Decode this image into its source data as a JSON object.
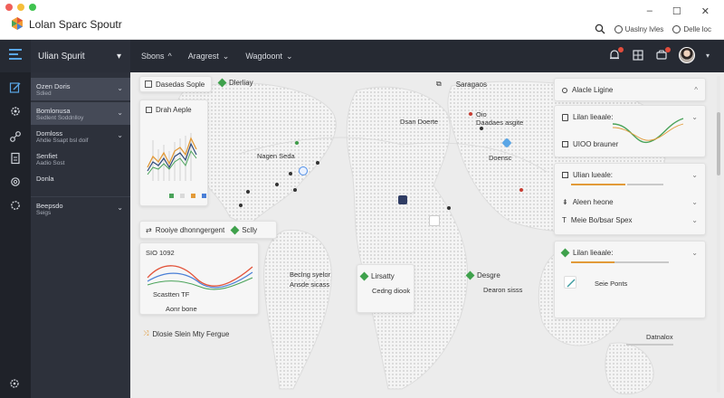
{
  "window": {
    "title": "Lolan Sparc Spoutr",
    "controls": {
      "minimize": "–",
      "maximize": "☐",
      "close": "✕"
    },
    "top_right": {
      "item1": "Uaslny lvles",
      "item2": "Delle loc"
    }
  },
  "navbar": {
    "project": "Ulian Spurit",
    "menu": [
      {
        "label": "Sbons",
        "chevron": "^"
      },
      {
        "label": "Aragrest",
        "chevron": "⌄"
      },
      {
        "label": "Wagdoont",
        "chevron": "⌄"
      }
    ]
  },
  "sidebar": {
    "items": [
      {
        "title": "Ozen Doris",
        "sub": "Sdied",
        "chevron": "⌄",
        "active": true
      },
      {
        "title": "Bomlonusa",
        "sub": "Sedlent Soddnlloy",
        "chevron": "⌄",
        "active": true
      },
      {
        "title": "Domloss",
        "sub": "Ahdie Ssapt bsl doif",
        "chevron": "⌄",
        "active": false
      },
      {
        "title": "Senfiet",
        "sub": "Aadio Sost",
        "chevron": "",
        "active": false
      },
      {
        "title": "Donla",
        "sub": "",
        "chevron": "",
        "active": false
      },
      {
        "title": "Beepsdo",
        "sub": "Seigs",
        "chevron": "⌄",
        "active": false
      }
    ]
  },
  "map": {
    "chips": {
      "top1": "Dasedas Sople",
      "top2": "Dlerliay",
      "top3": "Saragaos",
      "lbl1": "Dsan Doerte",
      "lbl2": "Oio",
      "lbl3": "Daadaes asgite",
      "lbl4": "Nagen Seda",
      "lbl5": "Doensc",
      "mid_strip": "Rooiye dhonngergent",
      "mid_strip2": "Sclly",
      "c1_l1": "Beclng syelor",
      "c1_l2": "Ansde sicass",
      "c2_l1": "Lirsatty",
      "c2_l2": "Cedng diook",
      "c3_l1": "Desgre",
      "c3_l2": "Dearon sisss",
      "bottom": "Dlosie Slein Mty Fergue"
    },
    "chart_card": {
      "title": "Drah Aeple"
    },
    "wave_card": {
      "title": "SIO 1092",
      "l1": "Scastten TF",
      "l2": "Aonr bone"
    }
  },
  "right_panel": {
    "r0": "Alacle Ligine",
    "r1": "Lilan lieaale:",
    "r2": "UIOO brauner",
    "r3": "Ulian lueale:",
    "r4": "Aleen heone",
    "r5": "Meie Bo/bsar Spex",
    "r6": "Lilan lieaale:",
    "r7": "Seie Ponts",
    "r8": "Datnalox",
    "colors": {
      "accent_green": "#3fa14c",
      "accent_orange": "#e29a38",
      "accent_teal": "#3d9ca0"
    }
  }
}
